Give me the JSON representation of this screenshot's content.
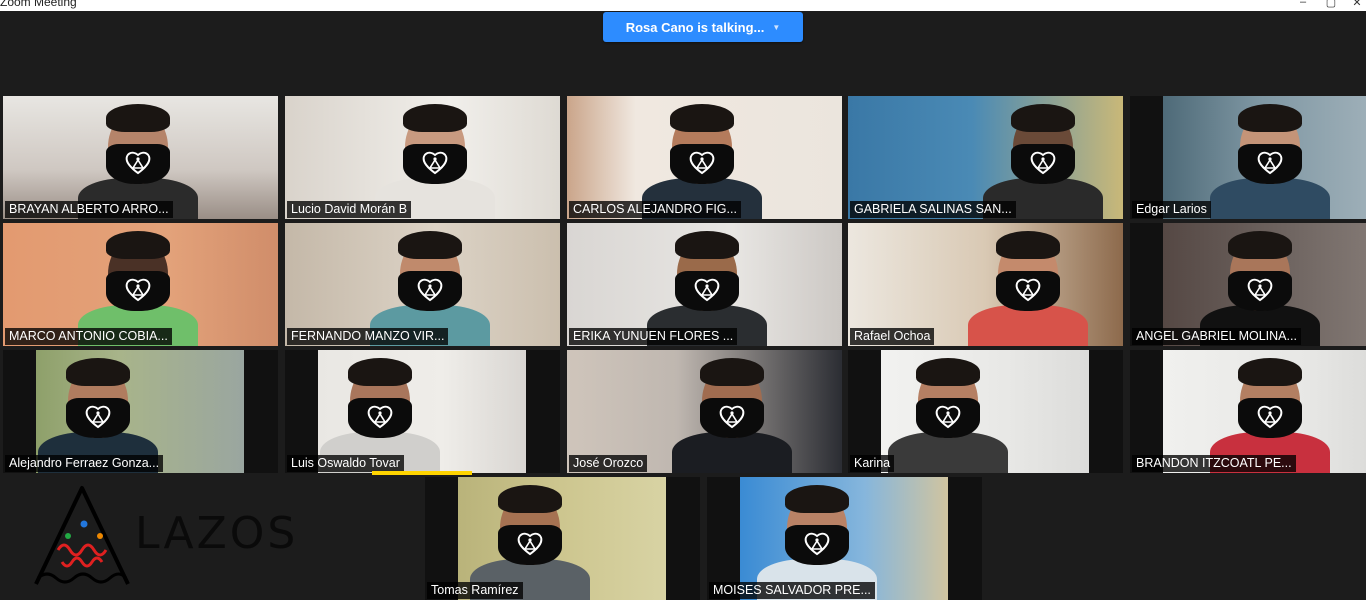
{
  "window": {
    "title": "Zoom Meeting"
  },
  "talking_indicator": {
    "label": "Rosa Cano is talking..."
  },
  "participants": [
    {
      "name": "BRAYAN ALBERTO ARRO..."
    },
    {
      "name": "Lucio David Morán B"
    },
    {
      "name": "CARLOS ALEJANDRO FIG..."
    },
    {
      "name": "GABRIELA SALINAS SAN..."
    },
    {
      "name": "Edgar Larios"
    },
    {
      "name": "MARCO ANTONIO COBIA..."
    },
    {
      "name": "FERNANDO MANZO VIR..."
    },
    {
      "name": "ERIKA YUNUEN FLORES ..."
    },
    {
      "name": "Rafael Ochoa"
    },
    {
      "name": "ANGEL GABRIEL MOLINA..."
    },
    {
      "name": "Alejandro Ferraez Gonza..."
    },
    {
      "name": "Luis Oswaldo Tovar"
    },
    {
      "name": "José Orozco"
    },
    {
      "name": "Karina"
    },
    {
      "name": "BRANDON ITZCOATL PE..."
    },
    {
      "name": "Tomas Ramírez"
    },
    {
      "name": "MOISES SALVADOR PRE..."
    }
  ],
  "logo": {
    "text": "LAZOS"
  },
  "colors": {
    "accent": "#2d8cff",
    "background": "#1c1c1c",
    "active_speaker": "#ffd400"
  }
}
